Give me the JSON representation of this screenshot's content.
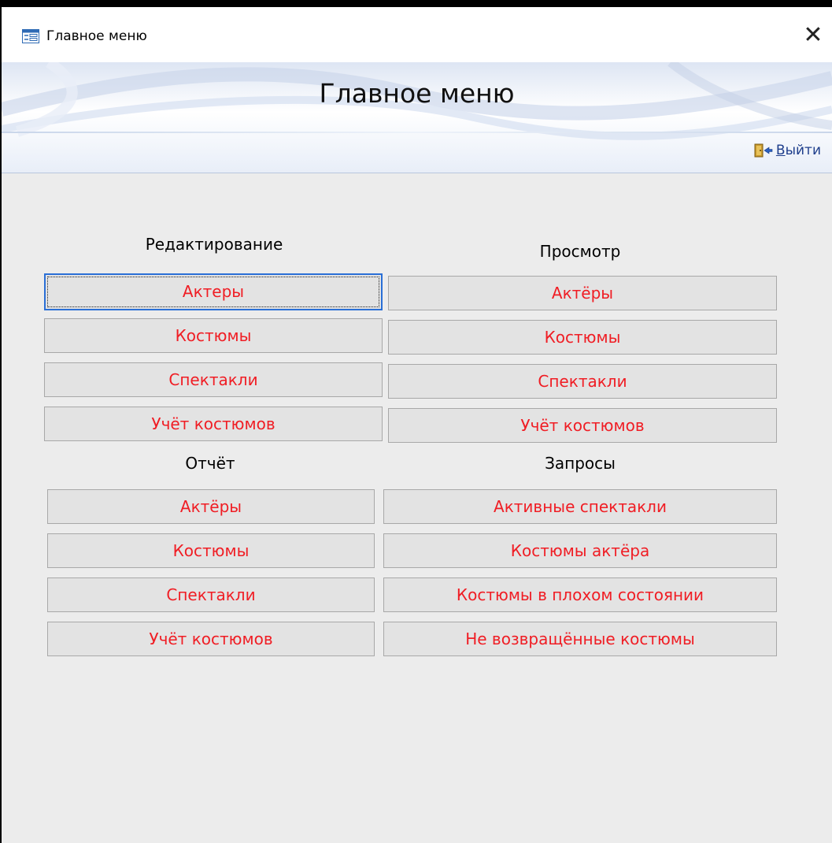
{
  "window": {
    "title": "Главное меню",
    "close_glyph": "✕"
  },
  "header": {
    "title": "Главное меню",
    "exit_label": "Выйти"
  },
  "sections": {
    "edit": {
      "label": "Редактирование",
      "buttons": [
        "Актеры",
        "Костюмы",
        "Спектакли",
        "Учёт костюмов"
      ]
    },
    "view": {
      "label": "Просмотр",
      "buttons": [
        "Актёры",
        "Костюмы",
        "Спектакли",
        "Учёт костюмов"
      ]
    },
    "report": {
      "label": "Отчёт",
      "buttons": [
        "Актёры",
        "Костюмы",
        "Спектакли",
        "Учёт костюмов"
      ]
    },
    "queries": {
      "label": "Запросы",
      "buttons": [
        "Активные спектакли",
        "Костюмы актёра",
        "Костюмы в плохом состоянии",
        "Не возвращённые костюмы"
      ]
    }
  },
  "colors": {
    "button_text": "#f01d24",
    "button_bg": "#e3e3e3",
    "form_bg": "#ececec",
    "focus_border": "#2a6fd6"
  },
  "icons": {
    "form": "form-icon",
    "close": "close-icon",
    "exit": "exit-door-icon"
  }
}
